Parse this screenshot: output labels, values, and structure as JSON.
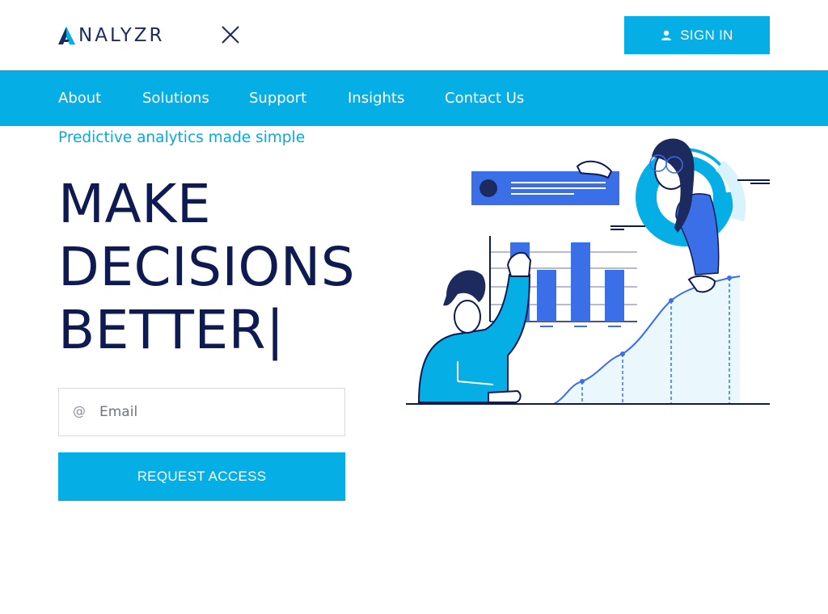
{
  "header": {
    "logo_text": "NALYZR",
    "signin_label": "SIGN IN",
    "icons": {
      "logo": "analyzr-logo-icon",
      "close": "close-icon",
      "user": "user-icon"
    }
  },
  "nav": {
    "items": [
      {
        "label": "About"
      },
      {
        "label": "Solutions"
      },
      {
        "label": "Support"
      },
      {
        "label": "Insights"
      },
      {
        "label": "Contact Us"
      }
    ]
  },
  "hero": {
    "tagline": "Predictive analytics made simple",
    "headline": [
      "MAKE",
      "DECISIONS",
      "BETTER|"
    ],
    "email": {
      "placeholder": "Email",
      "value": "",
      "icon": "at-sign-icon"
    },
    "cta_label": "REQUEST ACCESS"
  },
  "colors": {
    "brand": "#05aee4",
    "navy": "#0e1a52",
    "accent_blue": "#3b6fe8",
    "white": "#ffffff"
  }
}
